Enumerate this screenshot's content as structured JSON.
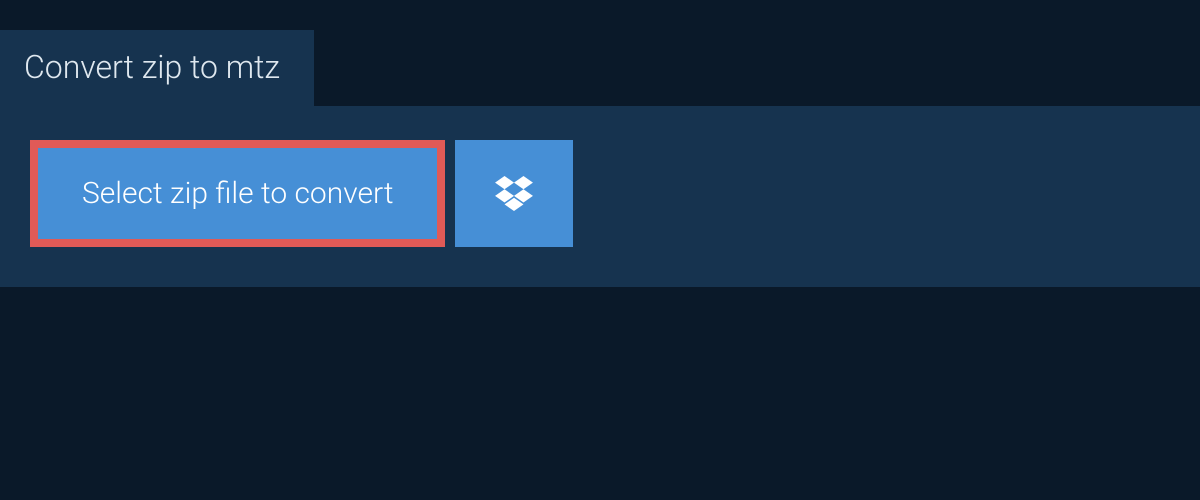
{
  "header": {
    "title": "Convert zip to mtz"
  },
  "actions": {
    "select_label": "Select zip file to convert"
  }
}
